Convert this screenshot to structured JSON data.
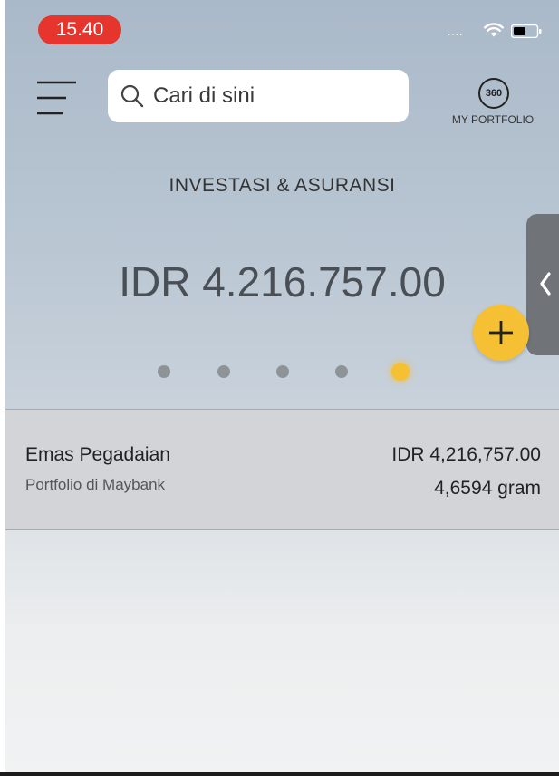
{
  "status_bar": {
    "time": "15.40",
    "signal": "....",
    "icons": [
      "wifi-icon",
      "battery-icon"
    ]
  },
  "header": {
    "menu_icon": "menu-icon",
    "search": {
      "placeholder": "Cari di sini",
      "icon": "search-icon"
    },
    "portfolio": {
      "badge": "360",
      "label": "MY PORTFOLIO"
    }
  },
  "hero": {
    "title": "INVESTASI & ASURANSI",
    "balance": "IDR 4.216.757.00",
    "pager": {
      "count": 5,
      "active_index": 4
    },
    "accent_color": "#f5c033",
    "add_icon": "plus-icon",
    "side_tab_icon": "chevron-left-icon"
  },
  "portfolio_items": [
    {
      "name": "Emas Pegadaian",
      "source": "Portfolio di Maybank",
      "amount": "IDR 4,216,757.00",
      "quantity": "4,6594 gram"
    }
  ],
  "colors": {
    "status_pill": "#e5352d",
    "accent": "#f5c033"
  }
}
